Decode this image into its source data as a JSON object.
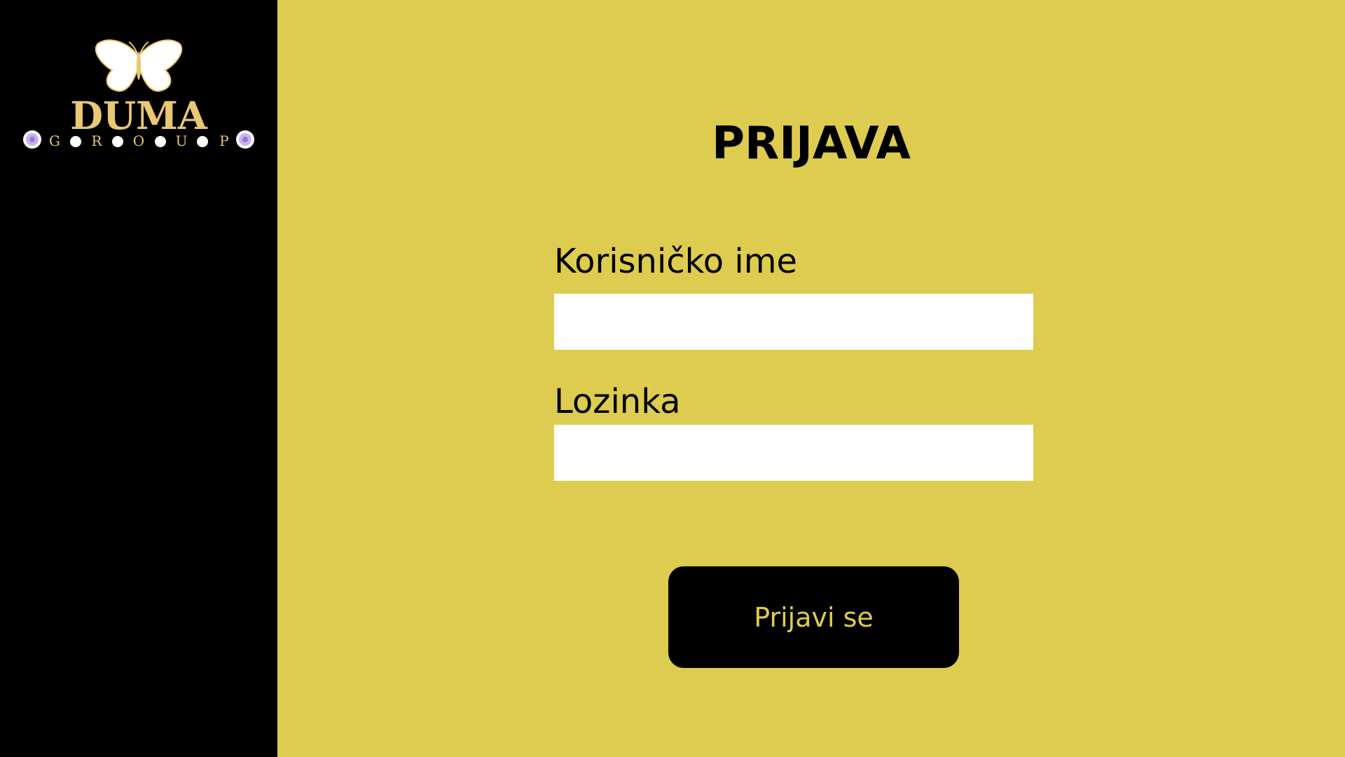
{
  "brand": {
    "name": "DUMA",
    "subtitle_letters": [
      "G",
      "R",
      "O",
      "U",
      "P"
    ],
    "logo_icon": "butterfly-icon",
    "accent_color": "#e8c873"
  },
  "login": {
    "title": "PRIJAVA",
    "username_label": "Korisničko ime",
    "username_value": "",
    "password_label": "Lozinka",
    "password_value": "",
    "submit_label": "Prijavi se"
  },
  "colors": {
    "sidebar_bg": "#000000",
    "main_bg": "#ddcc4f",
    "button_bg": "#000000",
    "button_text": "#ddcc4f",
    "input_bg": "#ffffff"
  }
}
